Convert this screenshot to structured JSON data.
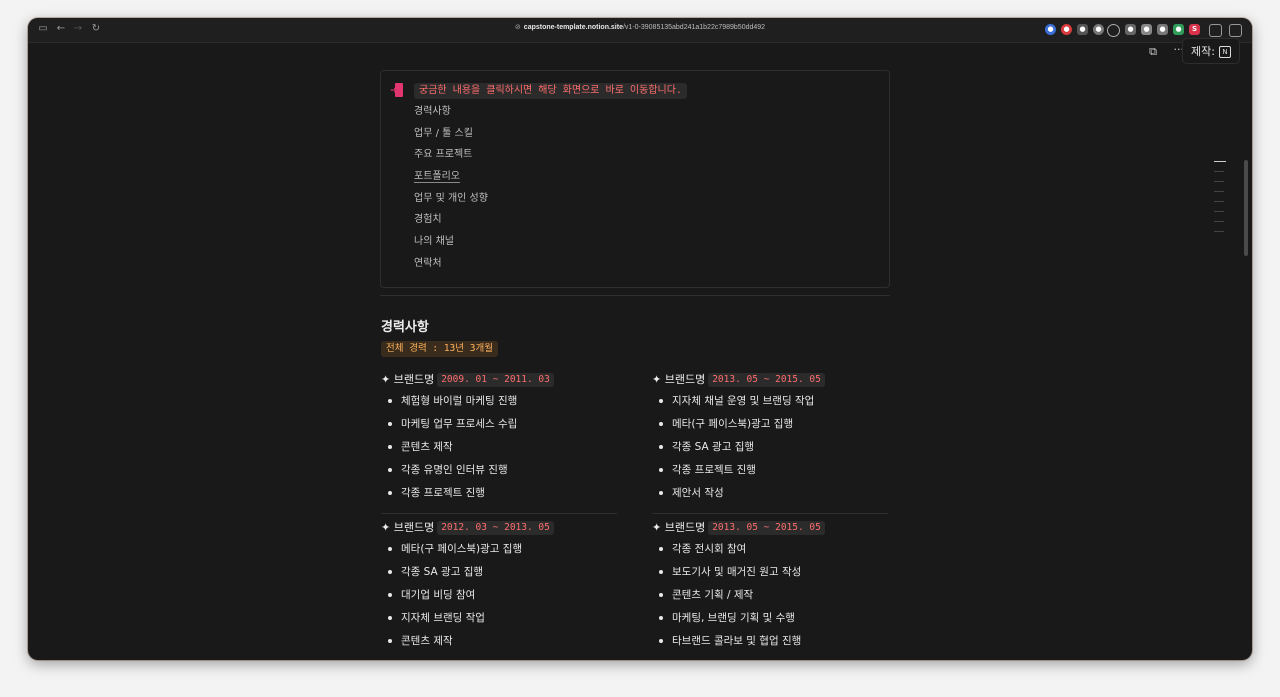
{
  "browser": {
    "url_host": "capstone-template.notion.site",
    "url_path": "/v1-0-39085135abd241a1b22c7989b50dd492"
  },
  "notion": {
    "made_with_label": "제작:"
  },
  "callout": {
    "title": "궁금한 내용을 클릭하시면 해당 화면으로 바로 이동합니다.",
    "items": [
      "경력사항",
      "업무 / 툴 스킬",
      "주요 프로젝트",
      "포트폴리오",
      "업무 및 개인 성향",
      "경험치",
      "나의 채널",
      "연락처"
    ]
  },
  "career": {
    "title": "경력사항",
    "total": "전체 경력 : 13년 3개월",
    "blocks": [
      {
        "brand": "✦ 브랜드명",
        "period": "2009. 01 ~ 2011. 03",
        "items": [
          "체험형 바이럴 마케팅 진행",
          "마케팅 업무 프로세스 수립",
          "콘텐츠 제작",
          "각종 유명인 인터뷰 진행",
          "각종 프로젝트 진행"
        ]
      },
      {
        "brand": "✦ 브랜드명",
        "period": "2013. 05 ~ 2015. 05",
        "items": [
          "지자체 채널 운영 및 브랜딩 작업",
          "메타(구 페이스북)광고 집행",
          "각종 SA 광고 집행",
          "각종 프로젝트 진행",
          "제안서 작성"
        ]
      },
      {
        "brand": "✦ 브랜드명",
        "period": "2012. 03 ~ 2013. 05",
        "items": [
          "메타(구 페이스북)광고 집행",
          "각종 SA 광고 집행",
          "대기업 비딩 참여",
          "지자체 브랜딩 작업",
          "콘텐츠 제작"
        ]
      },
      {
        "brand": "✦ 브랜드명",
        "period": "2013. 05 ~ 2015. 05",
        "items": [
          "각종 전시회 참여",
          "보도기사 및 매거진 원고 작성",
          "콘텐츠 기획 / 제작",
          "마케팅, 브랜딩 기획 및 수행",
          "타브랜드 콜라보 및 협업 진행"
        ]
      }
    ]
  }
}
